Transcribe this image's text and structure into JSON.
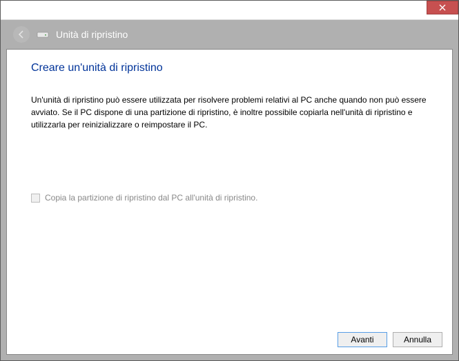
{
  "window": {
    "header_title": "Unità di ripristino"
  },
  "page": {
    "title": "Creare un'unità di ripristino",
    "description": "Un'unità di ripristino può essere utilizzata per risolvere problemi relativi al PC anche quando non può essere avviato. Se il PC dispone di una partizione di ripristino, è inoltre possibile copiarla nell'unità di ripristino e utilizzarla per reinizializzare o reimpostare il PC.",
    "checkbox_label": "Copia la partizione di ripristino dal PC all'unità di ripristino.",
    "checkbox_enabled": false,
    "checkbox_checked": false
  },
  "footer": {
    "next_label": "Avanti",
    "cancel_label": "Annulla"
  }
}
